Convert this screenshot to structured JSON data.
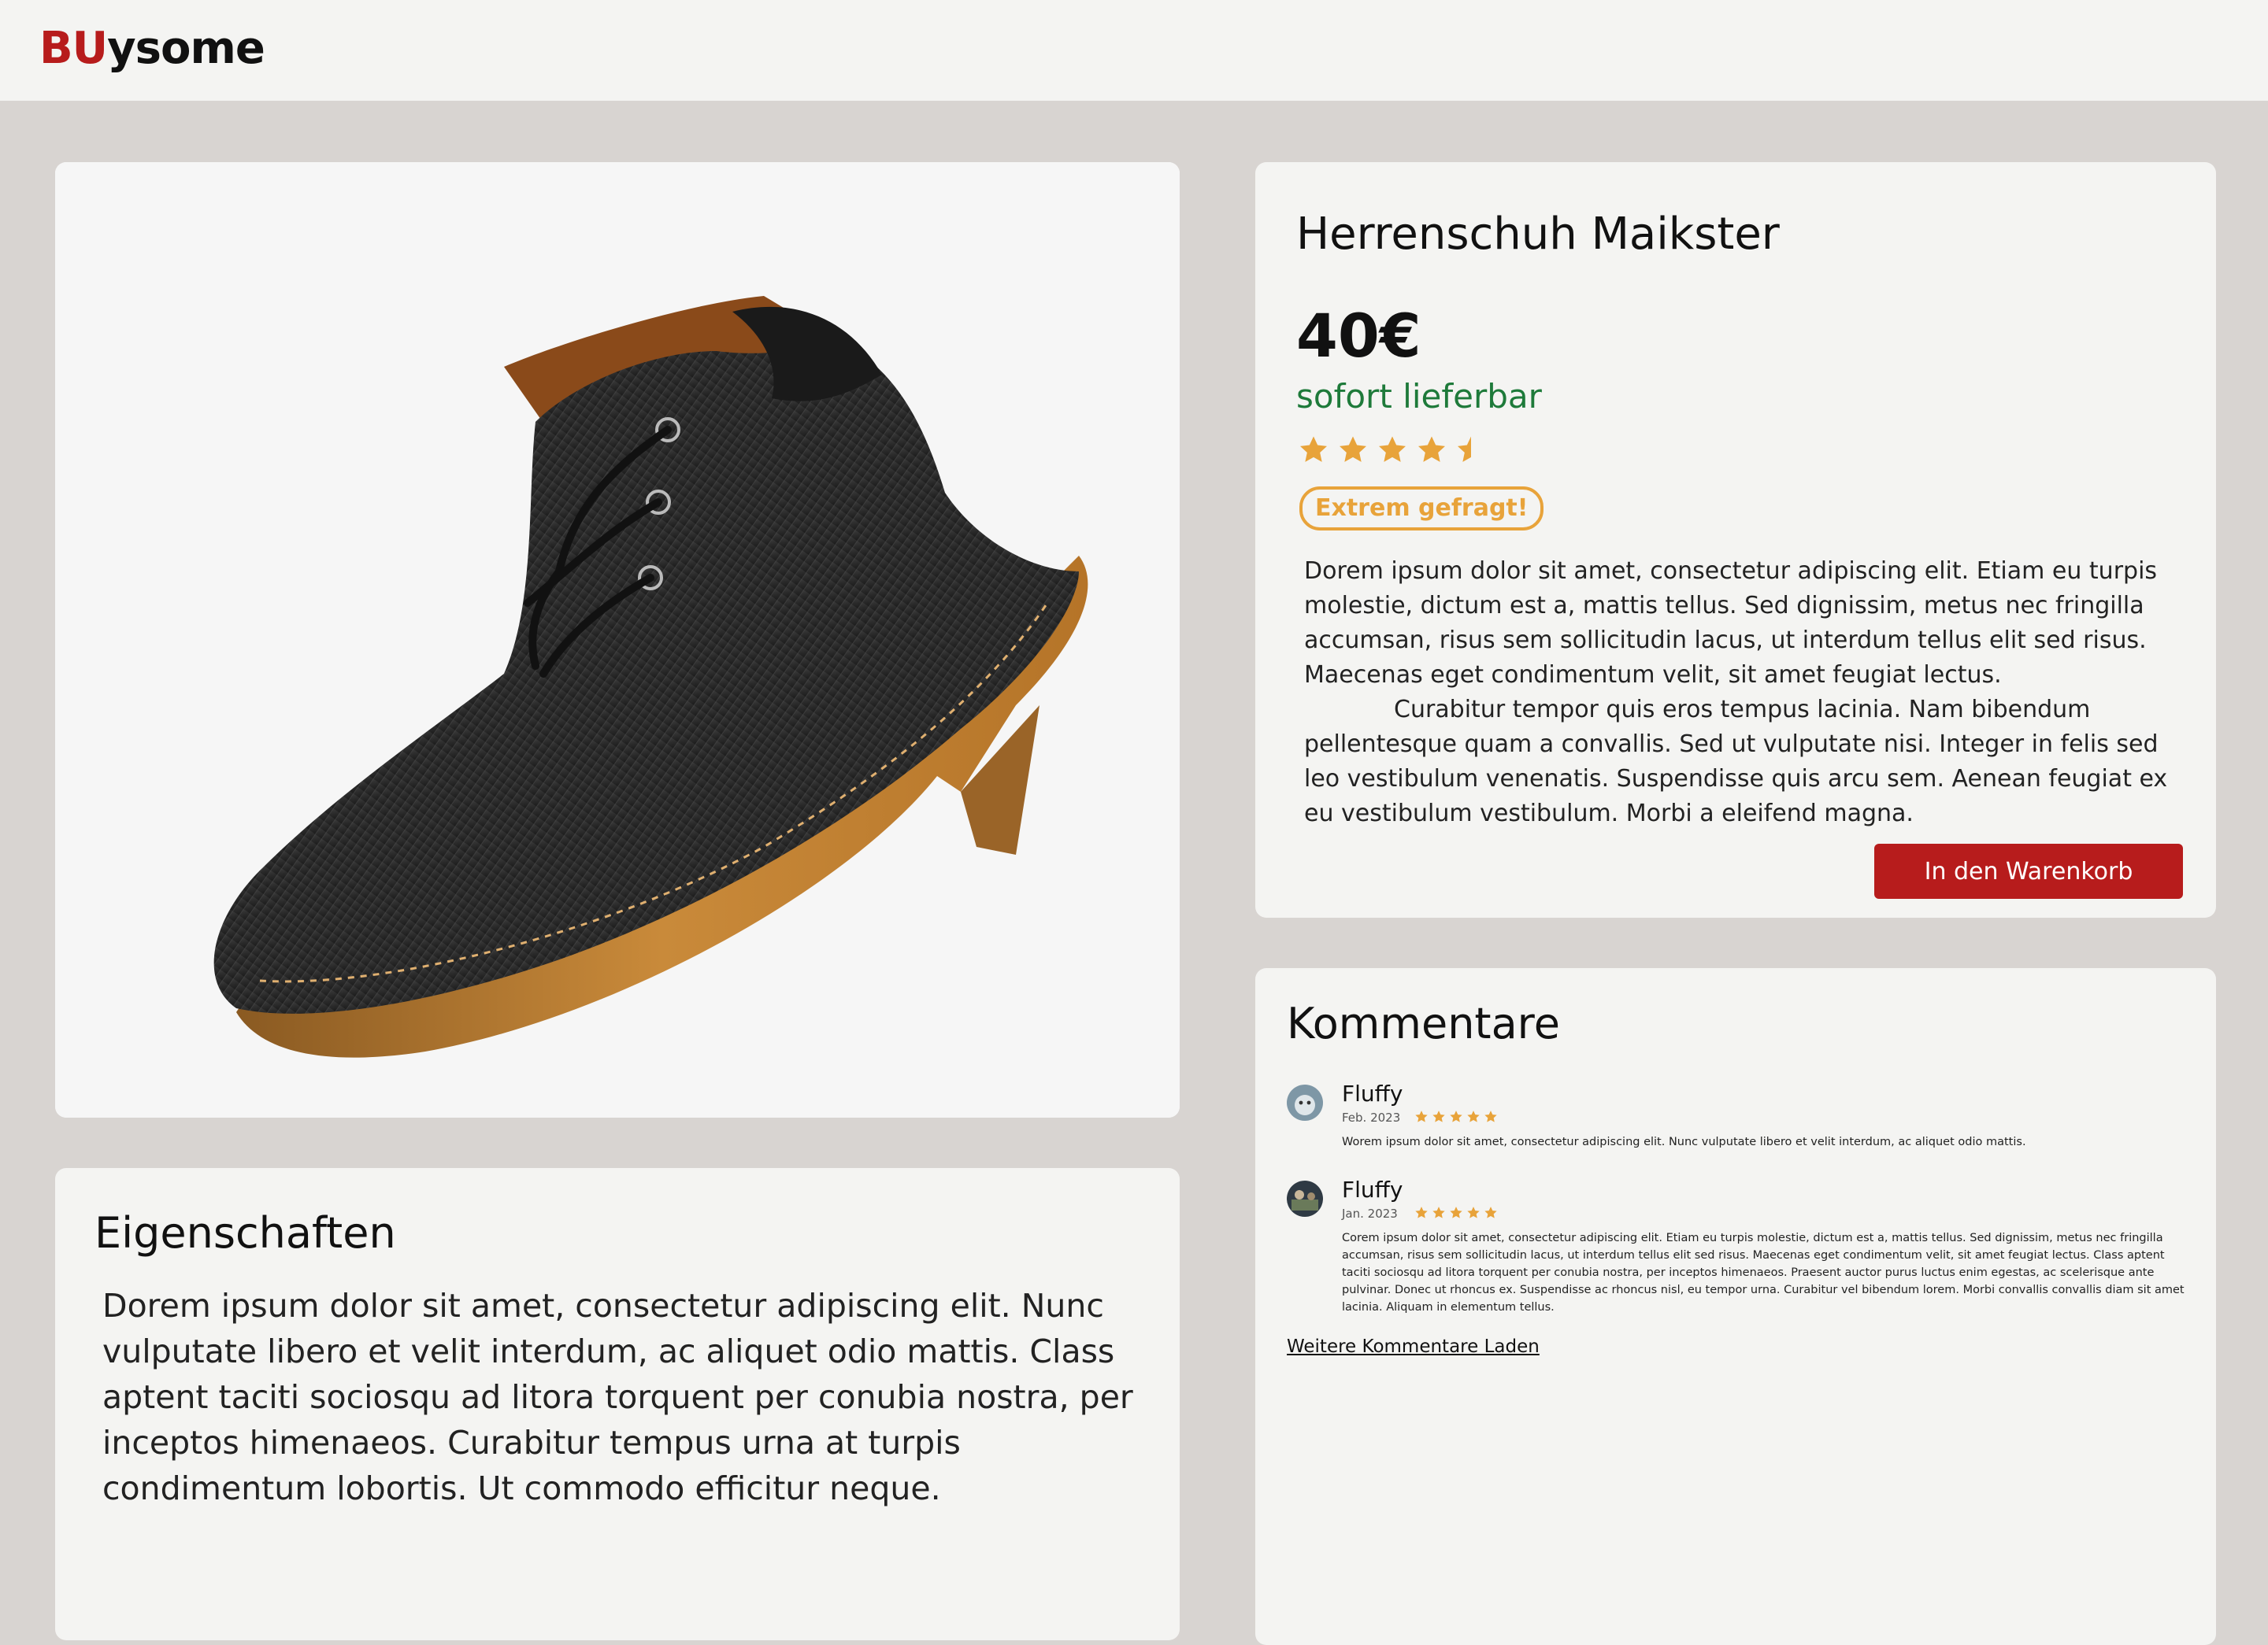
{
  "header": {
    "logo_bu": "BU",
    "logo_rest": "ysome"
  },
  "product": {
    "image_alt": "black denim chukka shoe",
    "title": "Herrenschuh Maikster",
    "price": "40€",
    "availability": "sofort lieferbar",
    "rating": 4.5,
    "rating_max": 5,
    "badge": "Extrem gefragt!",
    "description_p1": "Dorem ipsum dolor sit amet, consectetur adipiscing elit. Etiam eu turpis molestie, dictum est a, mattis tellus. Sed dignissim, metus nec fringilla accumsan, risus sem sollicitudin lacus, ut interdum tellus elit sed risus. Maecenas eget condimentum velit, sit amet feugiat lectus.",
    "description_p2": "Curabitur tempor quis eros tempus lacinia. Nam bibendum pellentesque quam a convallis. Sed ut vulputate nisi. Integer in felis sed leo vestibulum venenatis. Suspendisse quis arcu sem. Aenean feugiat ex eu vestibulum vestibulum. Morbi a eleifend magna.",
    "cart_button": "In den Warenkorb"
  },
  "properties": {
    "title": "Eigenschaften",
    "text": "Dorem ipsum dolor sit amet, consectetur adipiscing elit. Nunc vulputate libero et velit interdum, ac aliquet odio mattis. Class aptent taciti sociosqu ad litora torquent per conubia nostra, per inceptos himenaeos. Curabitur tempus urna at turpis condimentum lobortis. Ut commodo efficitur neque."
  },
  "comments": {
    "title": "Kommentare",
    "items": [
      {
        "name": "Fluffy",
        "date": "Feb. 2023",
        "rating": 5,
        "text": "Worem ipsum dolor sit amet, consectetur adipiscing elit. Nunc vulputate libero et velit interdum, ac aliquet odio mattis."
      },
      {
        "name": "Fluffy",
        "date": "Jan. 2023",
        "rating": 5,
        "text": "Corem ipsum dolor sit amet, consectetur adipiscing elit. Etiam eu turpis molestie, dictum est a, mattis tellus. Sed dignissim, metus nec fringilla accumsan, risus sem sollicitudin lacus, ut interdum tellus elit sed risus. Maecenas eget condimentum velit, sit amet feugiat lectus. Class aptent taciti sociosqu ad litora torquent per conubia nostra, per inceptos himenaeos. Praesent auctor purus luctus enim egestas, ac scelerisque ante pulvinar. Donec ut rhoncus ex. Suspendisse ac rhoncus nisl, eu tempor urna. Curabitur vel bibendum lorem. Morbi convallis convallis diam sit amet lacinia. Aliquam in elementum tellus."
      }
    ],
    "load_more": "Weitere Kommentare Laden"
  },
  "colors": {
    "brand": "#b71c1c",
    "available": "#1e7a3a",
    "star": "#e8a33a",
    "background": "#d8d4d1",
    "card": "#f4f4f2"
  }
}
